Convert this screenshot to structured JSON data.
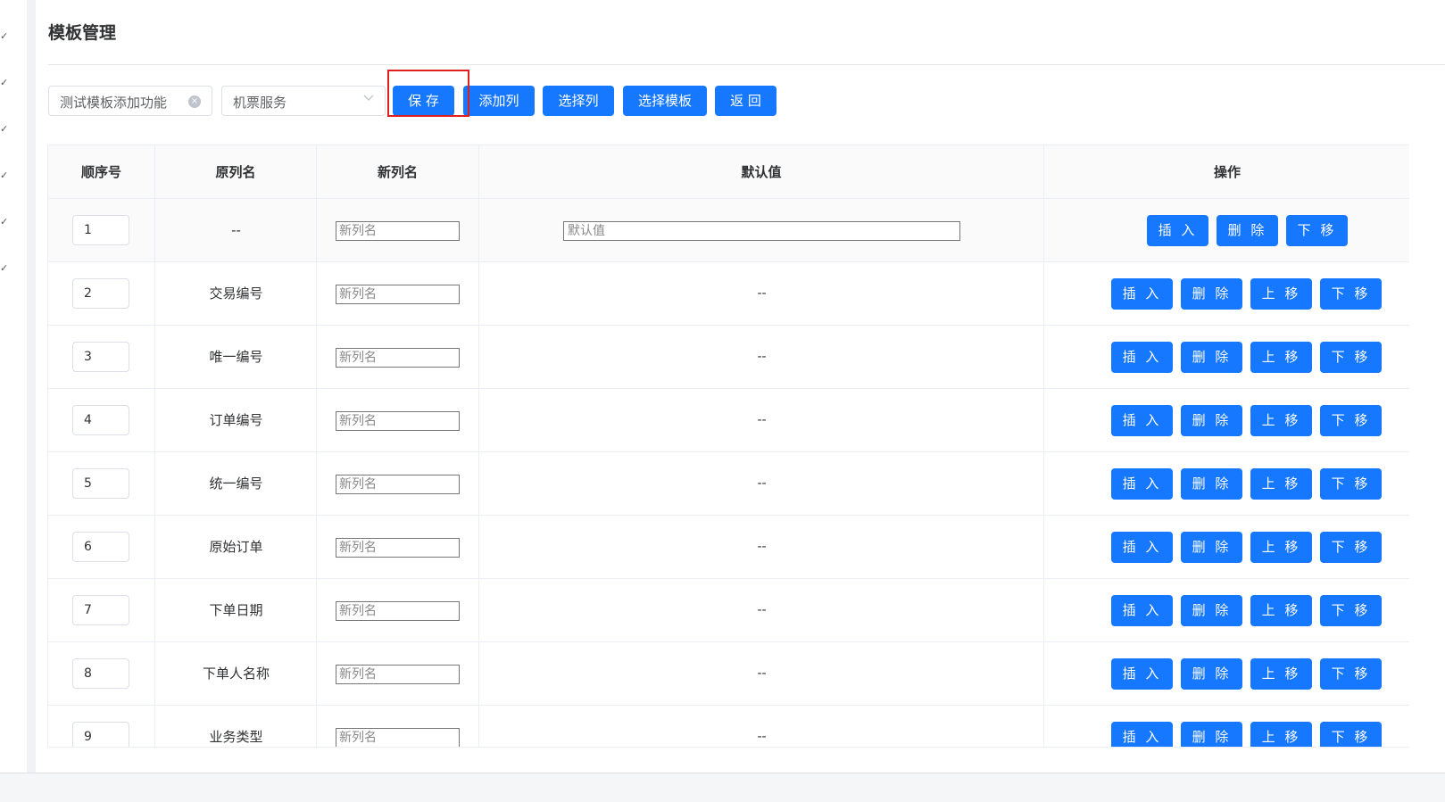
{
  "page": {
    "title": "模板管理"
  },
  "toolbar": {
    "template_name": "测试模板添加功能",
    "service_select": "机票服务",
    "save_label": "保 存",
    "add_column_label": "添加列",
    "select_column_label": "选择列",
    "select_template_label": "选择模板",
    "back_label": "返 回"
  },
  "table": {
    "headers": {
      "seq": "顺序号",
      "orig": "原列名",
      "new": "新列名",
      "default": "默认值",
      "ops": "操作"
    },
    "new_placeholder": "新列名",
    "default_placeholder": "默认值",
    "ops": {
      "insert": "插 入",
      "delete": "删 除",
      "up": "上 移",
      "down": "下 移"
    },
    "rows": [
      {
        "seq": "1",
        "orig": "--",
        "default": ""
      },
      {
        "seq": "2",
        "orig": "交易编号",
        "default": "--"
      },
      {
        "seq": "3",
        "orig": "唯一编号",
        "default": "--"
      },
      {
        "seq": "4",
        "orig": "订单编号",
        "default": "--"
      },
      {
        "seq": "5",
        "orig": "统一编号",
        "default": "--"
      },
      {
        "seq": "6",
        "orig": "原始订单",
        "default": "--"
      },
      {
        "seq": "7",
        "orig": "下单日期",
        "default": "--"
      },
      {
        "seq": "8",
        "orig": "下单人名称",
        "default": "--"
      },
      {
        "seq": "9",
        "orig": "业务类型",
        "default": "--"
      }
    ]
  },
  "colors": {
    "primary": "#1677ff",
    "highlight": "#e02020"
  }
}
